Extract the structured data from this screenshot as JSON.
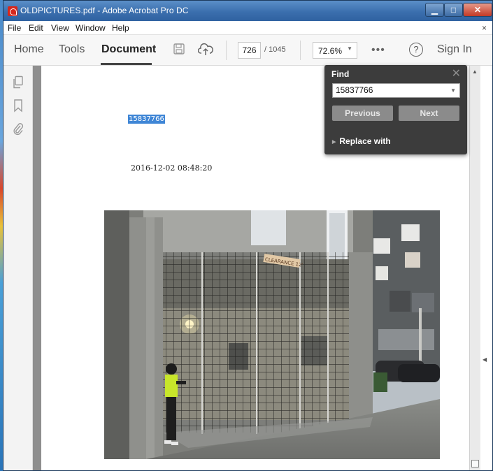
{
  "window": {
    "title": "OLDPICTURES.pdf - Adobe Acrobat Pro DC"
  },
  "menubar": {
    "items": [
      "File",
      "Edit",
      "View",
      "Window",
      "Help"
    ],
    "close": "×"
  },
  "toolbar": {
    "tabs": [
      "Home",
      "Tools",
      "Document"
    ],
    "active_tab": "Document",
    "page_current": "726",
    "page_total": "/ 1045",
    "zoom": "72.6%",
    "more": "•••",
    "help": "?",
    "sign_in": "Sign In",
    "icons": [
      "save-icon",
      "cloud-upload-icon"
    ]
  },
  "left_pane": {
    "icons": [
      "copy-pages-icon",
      "bookmark-icon",
      "attachment-icon"
    ]
  },
  "document": {
    "highlighted_text": "15837766",
    "timestamp": "2016-12-02 08:48:20",
    "photo_sign": "CLEARANCE 12'"
  },
  "find_panel": {
    "title": "Find",
    "close": "✕",
    "query": "15837766",
    "previous_label": "Previous",
    "next_label": "Next",
    "replace_label": "Replace with"
  },
  "colors": {
    "titlebar": "#3b6fae",
    "highlight": "#3f86d6",
    "find_bg": "#3c3c3c"
  }
}
